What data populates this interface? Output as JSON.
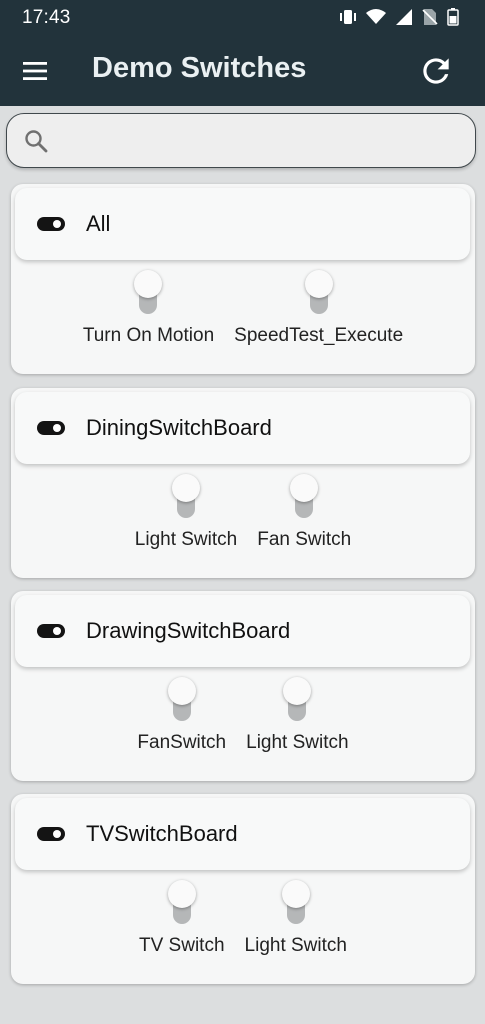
{
  "status_bar": {
    "time": "17:43"
  },
  "app_bar": {
    "title": "Demo Switches"
  },
  "search": {
    "placeholder": "",
    "value": ""
  },
  "boards": [
    {
      "title": "All",
      "switches": [
        {
          "label": "Turn On Motion",
          "on": false
        },
        {
          "label": "SpeedTest_Execute",
          "on": false
        }
      ]
    },
    {
      "title": "DiningSwitchBoard",
      "switches": [
        {
          "label": "Light Switch",
          "on": false
        },
        {
          "label": "Fan Switch",
          "on": false
        }
      ]
    },
    {
      "title": "DrawingSwitchBoard",
      "switches": [
        {
          "label": "FanSwitch",
          "on": false
        },
        {
          "label": "Light Switch",
          "on": false
        }
      ]
    },
    {
      "title": "TVSwitchBoard",
      "switches": [
        {
          "label": "TV Switch",
          "on": false
        },
        {
          "label": "Light Switch",
          "on": false
        }
      ]
    }
  ],
  "colors": {
    "app_bar": "#22333b",
    "background": "#dcdedf",
    "card": "#f6f7f7",
    "switch_track_off": "#b5b7b8"
  },
  "icons": {
    "menu": "menu-icon",
    "refresh": "refresh-icon",
    "search": "search-icon",
    "board": "toggle-icon"
  }
}
